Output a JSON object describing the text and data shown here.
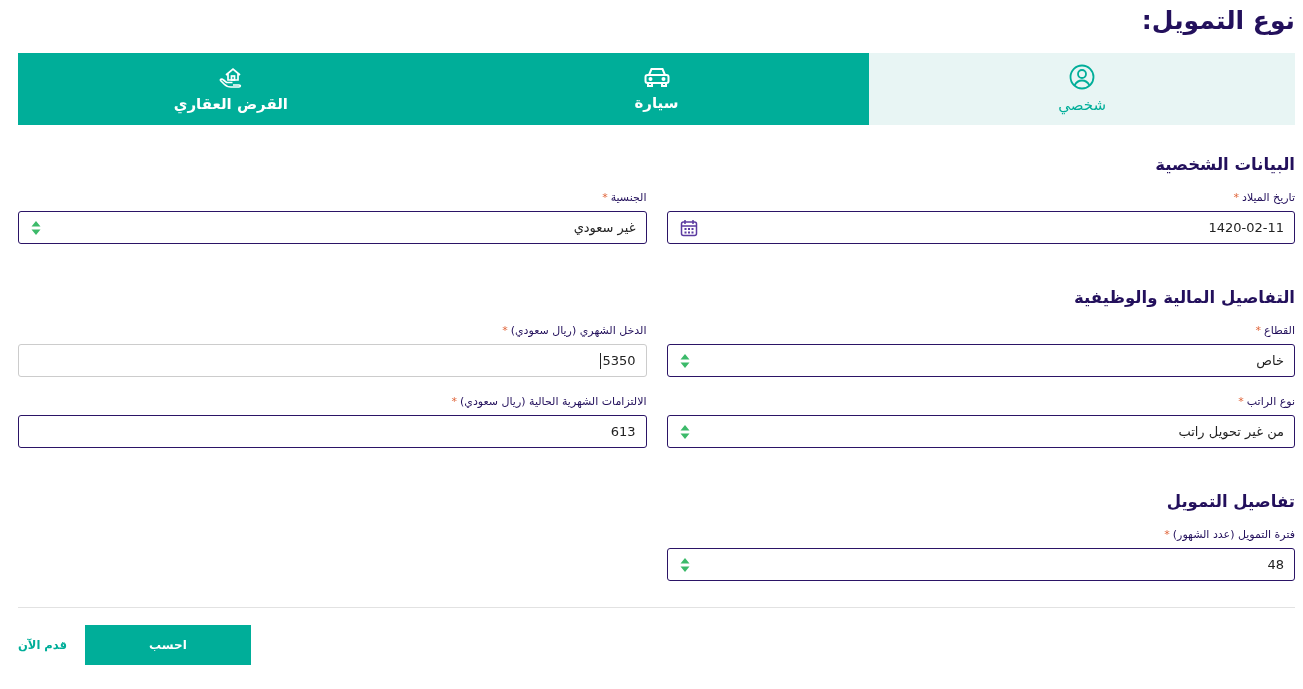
{
  "title": "نوع التمويل:",
  "tabs": [
    {
      "label": "شخصي",
      "kind": "user",
      "selected": true
    },
    {
      "label": "سيارة",
      "kind": "car",
      "selected": false
    },
    {
      "label": "القرض العقاري",
      "kind": "house",
      "selected": false
    }
  ],
  "sections": [
    {
      "heading": "البيانات الشخصية",
      "fields": [
        {
          "label": "تاريخ الميلاد",
          "mark": "*",
          "kind": "date",
          "value": "1420-02-11",
          "focused": false
        },
        {
          "label": "الجنسية",
          "mark": "*",
          "kind": "select",
          "value": "غير سعودي",
          "focused": false
        }
      ]
    },
    {
      "heading": "التفاصيل المالية والوظيفية",
      "fields": [
        {
          "label": "القطاع",
          "mark": "*",
          "kind": "select",
          "value": "خاص",
          "focused": false
        },
        {
          "label": "الدخل الشهري (ريال سعودي)",
          "mark": "*",
          "kind": "input",
          "value": "5350",
          "focused": true
        },
        {
          "label": "نوع الراتب",
          "mark": "*",
          "kind": "select",
          "value": "من غير تحويل راتب",
          "focused": false
        },
        {
          "label": "الالتزامات الشهرية الحالية (ريال سعودي)",
          "mark": "*",
          "kind": "input",
          "value": "613",
          "focused": false
        }
      ]
    },
    {
      "heading": "تفاصيل التمويل",
      "fields": [
        {
          "label": "فترة التمويل (عدد الشهور)",
          "mark": "*",
          "kind": "select",
          "value": "48",
          "focused": false
        }
      ]
    }
  ],
  "footer": {
    "button": "احسب",
    "link": "قدم الآن"
  }
}
